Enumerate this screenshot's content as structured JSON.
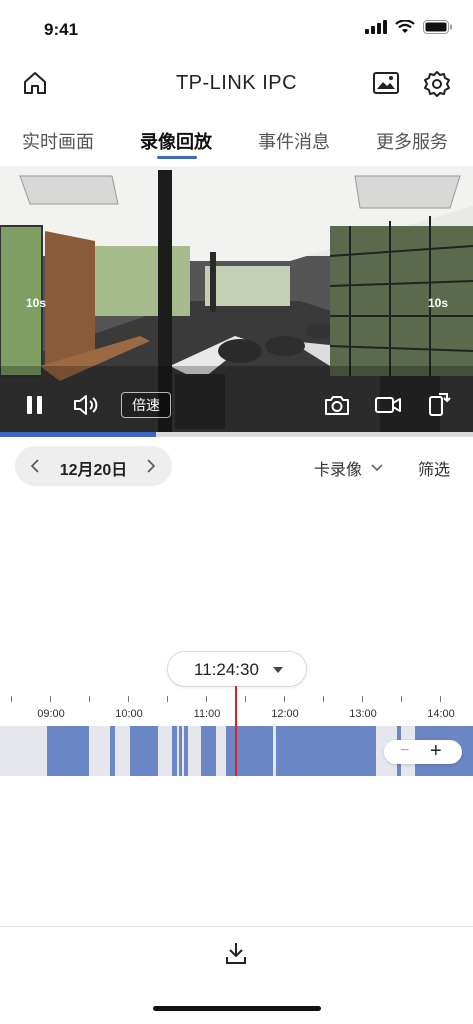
{
  "status_bar": {
    "time": "9:41"
  },
  "header": {
    "title": "TP-LINK IPC"
  },
  "tabs": [
    {
      "label": "实时画面",
      "active": false
    },
    {
      "label": "录像回放",
      "active": true
    },
    {
      "label": "事件消息",
      "active": false
    },
    {
      "label": "更多服务",
      "active": false
    }
  ],
  "player": {
    "seek_back_label": "10s",
    "seek_forward_label": "10s",
    "speed_label": "倍速",
    "progress": 0.33
  },
  "date_nav": {
    "date": "12月20日"
  },
  "storage": {
    "label": "卡录像"
  },
  "filter": {
    "label": "筛选"
  },
  "timeline": {
    "current_time": "11:24:30",
    "labels": [
      "09:00",
      "10:00",
      "11:00",
      "12:00",
      "13:00",
      "14:00"
    ]
  },
  "colors": {
    "accent": "#3d66c7",
    "segment": "#6b86c4",
    "playhead": "#e02020"
  },
  "icons": [
    "home-icon",
    "gallery-icon",
    "settings-icon",
    "pause-icon",
    "volume-icon",
    "camera-icon",
    "record-icon",
    "rotate-icon",
    "download-icon"
  ]
}
